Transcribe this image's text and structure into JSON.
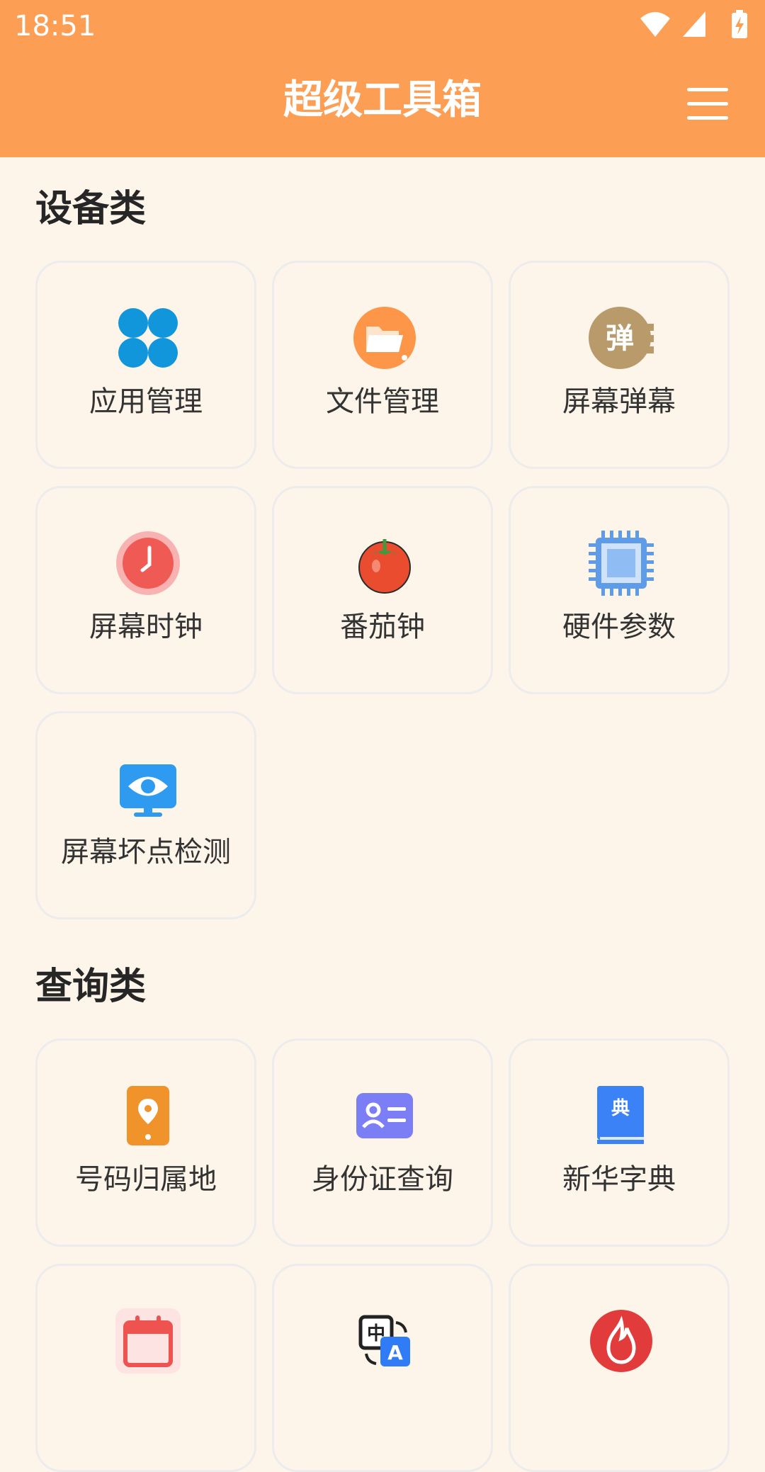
{
  "status_bar": {
    "time": "18:51"
  },
  "header": {
    "title": "超级工具箱"
  },
  "sections": [
    {
      "title": "设备类",
      "items": [
        {
          "label": "应用管理",
          "icon": "app-grid-icon"
        },
        {
          "label": "文件管理",
          "icon": "folder-icon"
        },
        {
          "label": "屏幕弹幕",
          "icon": "danmaku-icon",
          "icon_text": "弹"
        },
        {
          "label": "屏幕时钟",
          "icon": "clock-icon"
        },
        {
          "label": "番茄钟",
          "icon": "tomato-icon"
        },
        {
          "label": "硬件参数",
          "icon": "chip-icon"
        },
        {
          "label": "屏幕坏点检测",
          "icon": "monitor-eye-icon"
        }
      ]
    },
    {
      "title": "查询类",
      "items": [
        {
          "label": "号码归属地",
          "icon": "phone-location-icon"
        },
        {
          "label": "身份证查询",
          "icon": "id-card-icon"
        },
        {
          "label": "新华字典",
          "icon": "dictionary-icon",
          "icon_text": "典"
        },
        {
          "label": "",
          "icon": "calendar-icon"
        },
        {
          "label": "",
          "icon": "translate-icon",
          "icon_text": "中",
          "icon_text_2": "A"
        },
        {
          "label": "",
          "icon": "fire-icon"
        }
      ]
    }
  ],
  "colors": {
    "appbar": "#fd9e55",
    "background": "#fdf5ea",
    "card_border": "#ececec"
  }
}
